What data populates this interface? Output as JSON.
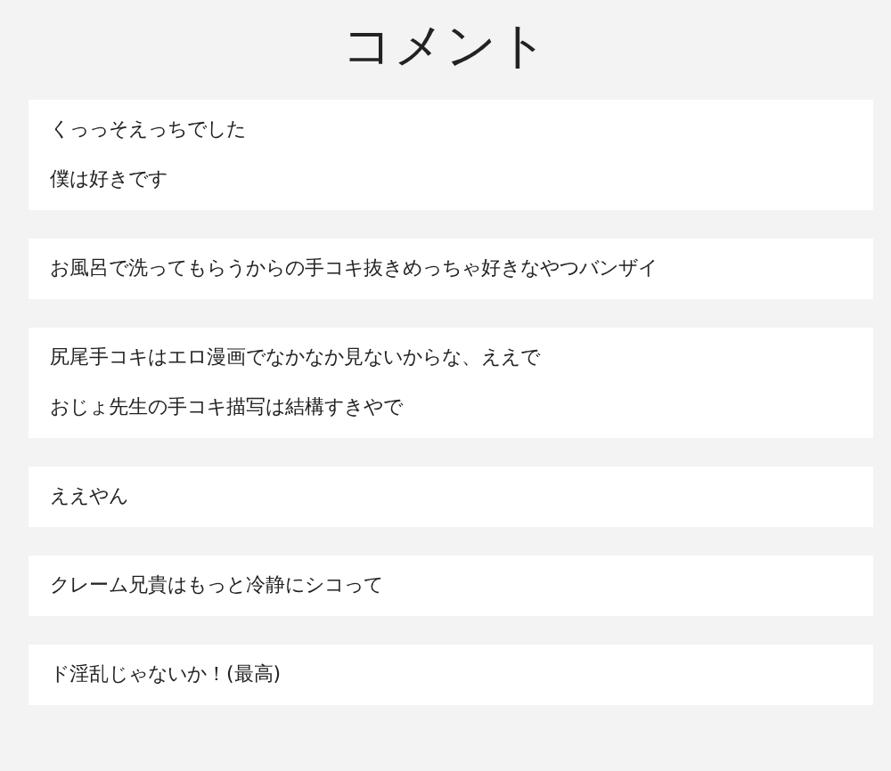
{
  "title": "コメント",
  "comments": [
    {
      "lines": [
        "くっっそえっちでした",
        "僕は好きです"
      ]
    },
    {
      "lines": [
        "お風呂で洗ってもらうからの手コキ抜きめっちゃ好きなやつバンザイ"
      ]
    },
    {
      "lines": [
        "尻尾手コキはエロ漫画でなかなか見ないからな、ええで",
        "おじょ先生の手コキ描写は結構すきやで"
      ]
    },
    {
      "lines": [
        "ええやん"
      ]
    },
    {
      "lines": [
        "クレーム兄貴はもっと冷静にシコって"
      ]
    },
    {
      "lines": [
        "ド淫乱じゃないか！(最高)"
      ]
    }
  ]
}
